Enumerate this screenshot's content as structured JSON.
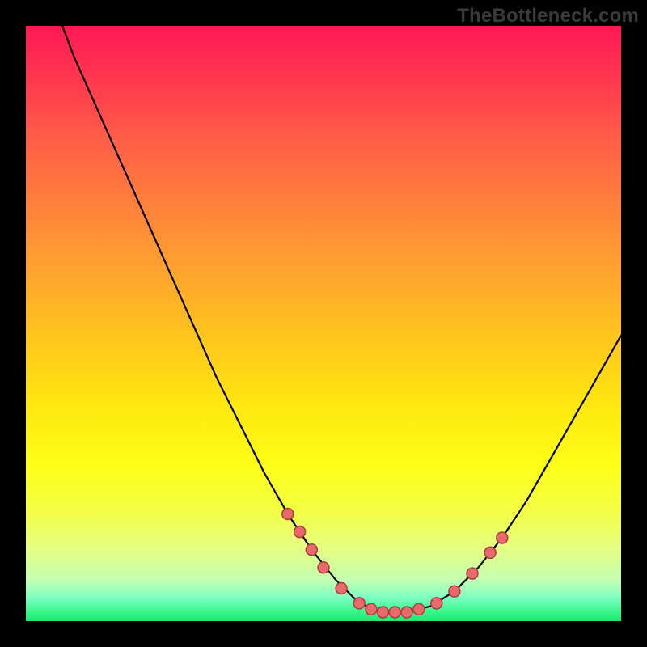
{
  "watermark": "TheBottleneck.com",
  "colors": {
    "dot_fill": "#e86a6d",
    "dot_stroke": "#a83e3e",
    "curve": "#000000",
    "gradient_top": "#ff1854",
    "gradient_bottom": "#1ee671"
  },
  "chart_data": {
    "type": "line",
    "title": "",
    "xlabel": "",
    "ylabel": "",
    "xlim": [
      0,
      100
    ],
    "ylim": [
      0,
      100
    ],
    "curve": [
      {
        "x": 5,
        "y": 103
      },
      {
        "x": 8,
        "y": 95
      },
      {
        "x": 12,
        "y": 86
      },
      {
        "x": 16,
        "y": 77
      },
      {
        "x": 20,
        "y": 68
      },
      {
        "x": 24,
        "y": 59
      },
      {
        "x": 28,
        "y": 50
      },
      {
        "x": 32,
        "y": 41
      },
      {
        "x": 36,
        "y": 33
      },
      {
        "x": 40,
        "y": 25
      },
      {
        "x": 44,
        "y": 18
      },
      {
        "x": 48,
        "y": 12
      },
      {
        "x": 52,
        "y": 7
      },
      {
        "x": 56,
        "y": 3
      },
      {
        "x": 60,
        "y": 1.5
      },
      {
        "x": 64,
        "y": 1.5
      },
      {
        "x": 68,
        "y": 2.5
      },
      {
        "x": 72,
        "y": 5
      },
      {
        "x": 76,
        "y": 9
      },
      {
        "x": 80,
        "y": 14
      },
      {
        "x": 84,
        "y": 20
      },
      {
        "x": 88,
        "y": 27
      },
      {
        "x": 92,
        "y": 34
      },
      {
        "x": 96,
        "y": 41
      },
      {
        "x": 100,
        "y": 48
      }
    ],
    "dots": [
      {
        "x": 44,
        "y": 18
      },
      {
        "x": 46,
        "y": 15
      },
      {
        "x": 48,
        "y": 12
      },
      {
        "x": 50,
        "y": 9
      },
      {
        "x": 53,
        "y": 5.5
      },
      {
        "x": 56,
        "y": 3
      },
      {
        "x": 58,
        "y": 2
      },
      {
        "x": 60,
        "y": 1.5
      },
      {
        "x": 62,
        "y": 1.5
      },
      {
        "x": 64,
        "y": 1.5
      },
      {
        "x": 66,
        "y": 2
      },
      {
        "x": 69,
        "y": 3
      },
      {
        "x": 72,
        "y": 5
      },
      {
        "x": 75,
        "y": 8
      },
      {
        "x": 78,
        "y": 11.5
      },
      {
        "x": 80,
        "y": 14
      }
    ],
    "dot_radius_px": 7
  }
}
